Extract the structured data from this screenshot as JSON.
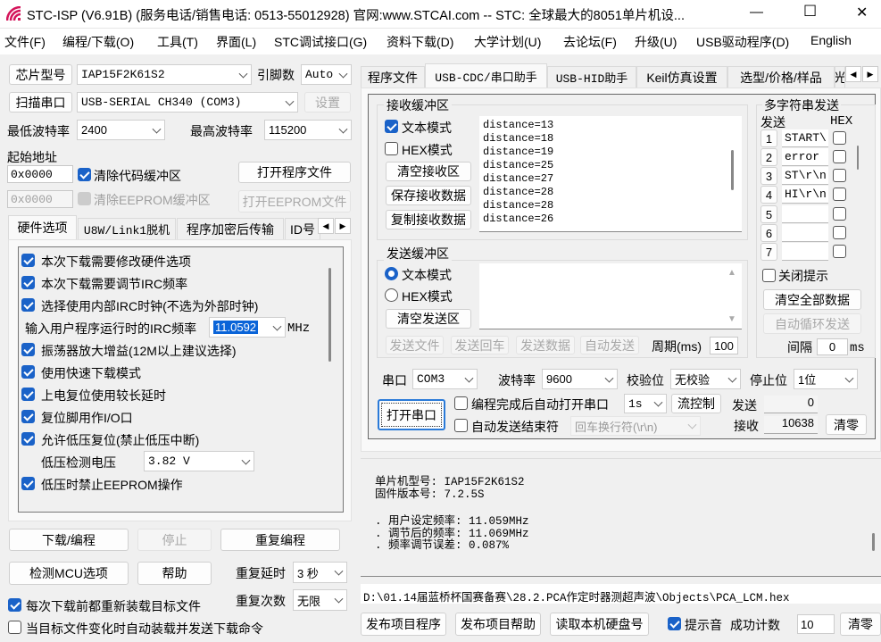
{
  "window": {
    "title": "STC-ISP (V6.91B) (服务电话/销售电话: 0513-55012928) 官网:www.STCAI.com  -- STC: 全球最大的8051单片机设...",
    "minimize": "—",
    "maximize": "☐",
    "close": "✕"
  },
  "menu": [
    "文件(F)",
    "编程/下载(O)",
    "工具(T)",
    "界面(L)",
    "STC调试接口(G)",
    "资料下载(D)",
    "大学计划(U)",
    "去论坛(F)",
    "升级(U)",
    "USB驱动程序(D)",
    "English"
  ],
  "left": {
    "chip_btn": "芯片型号",
    "chip": "IAP15F2K61S2",
    "pins_label": "引脚数",
    "pins": "Auto",
    "scan_btn": "扫描串口",
    "port": "USB-SERIAL CH340 (COM3)",
    "settings_btn": "设置",
    "min_baud_label": "最低波特率",
    "min_baud": "2400",
    "max_baud_label": "最高波特率",
    "max_baud": "115200",
    "start_addr_label": "起始地址",
    "code_addr": "0x0000",
    "clear_code": "清除代码缓冲区",
    "open_prog": "打开程序文件",
    "eeprom_addr": "0x0000",
    "clear_eeprom": "清除EEPROM缓冲区",
    "open_eeprom": "打开EEPROM文件",
    "tabs": [
      "硬件选项",
      "U8W/Link1脱机",
      "程序加密后传输",
      "ID号"
    ],
    "options": [
      {
        "label": "本次下载需要修改硬件选项",
        "checked": true
      },
      {
        "label": "本次下载需要调节IRC频率",
        "checked": true
      },
      {
        "label": "选择使用内部IRC时钟(不选为外部时钟)",
        "checked": true
      }
    ],
    "irc_label": "输入用户程序运行时的IRC频率",
    "irc_value": "11.0592",
    "irc_unit": "MHz",
    "options2": [
      {
        "label": "振荡器放大增益(12M以上建议选择)",
        "checked": true
      },
      {
        "label": "使用快速下载模式",
        "checked": true
      },
      {
        "label": "上电复位使用较长延时",
        "checked": true
      },
      {
        "label": "复位脚用作I/O口",
        "checked": true
      },
      {
        "label": "允许低压复位(禁止低压中断)",
        "checked": true
      }
    ],
    "lvd_label": "低压检测电压",
    "lvd_value": "3.82 V",
    "eeprom_lv": "低压时禁止EEPROM操作",
    "download_btn": "下载/编程",
    "stop_btn": "停止",
    "repeat_btn": "重复编程",
    "detect_btn": "检测MCU选项",
    "help_btn": "帮助",
    "repeat_delay_label": "重复延时",
    "repeat_delay": "3 秒",
    "repeat_count_label": "重复次数",
    "repeat_count": "无限",
    "reload": "每次下载前都重新装载目标文件",
    "auto_load": "当目标文件变化时自动装载并发送下载命令"
  },
  "right": {
    "tabs": [
      "程序文件",
      "USB-CDC/串口助手",
      "USB-HID助手",
      "Keil仿真设置",
      "选型/价格/样品",
      "光"
    ],
    "recv": {
      "title": "接收缓冲区",
      "text_mode": "文本模式",
      "hex_mode": "HEX模式",
      "clear": "清空接收区",
      "save": "保存接收数据",
      "copy": "复制接收数据",
      "lines": [
        "distance=13",
        "distance=18",
        "distance=19",
        "distance=25",
        "distance=27",
        "distance=28",
        "distance=28",
        "distance=26"
      ]
    },
    "send": {
      "title": "发送缓冲区",
      "text_mode": "文本模式",
      "hex_mode": "HEX模式",
      "clear": "清空发送区",
      "send_file": "发送文件",
      "send_cr": "发送回车",
      "send_data": "发送数据",
      "auto_send": "自动发送",
      "period_label": "周期(ms)",
      "period": "100"
    },
    "multi": {
      "title": "多字符串发送",
      "send_col": "发送",
      "hex_col": "HEX",
      "rows": [
        {
          "n": "1",
          "v": "START\\:"
        },
        {
          "n": "2",
          "v": "error"
        },
        {
          "n": "3",
          "v": "ST\\r\\n"
        },
        {
          "n": "4",
          "v": "HI\\r\\n"
        },
        {
          "n": "5",
          "v": ""
        },
        {
          "n": "6",
          "v": ""
        },
        {
          "n": "7",
          "v": ""
        }
      ],
      "close_tip": "关闭提示",
      "clear_all": "清空全部数据",
      "auto_loop": "自动循环发送",
      "interval_label": "间隔",
      "interval": "0",
      "ms": "ms"
    },
    "serial": {
      "port_label": "串口",
      "port": "COM3",
      "baud_label": "波特率",
      "baud": "9600",
      "parity_label": "校验位",
      "parity": "无校验",
      "stop_label": "停止位",
      "stop": "1位",
      "open_btn": "打开串口",
      "auto_open": "编程完成后自动打开串口",
      "auto_open_delay": "1s",
      "flow_btn": "流控制",
      "sent_label": "发送",
      "sent": "0",
      "auto_end": "自动发送结束符",
      "end_char": "回车换行符(\\r\\n)",
      "recv_label": "接收",
      "recv": "10638",
      "clear_btn": "清零"
    }
  },
  "log": {
    "lines": [
      "单片机型号: IAP15F2K61S2",
      "固件版本号: 7.2.5S",
      "",
      ". 用户设定频率: 11.059MHz",
      ". 调节后的频率: 11.069MHz",
      ". 频率调节误差: 0.087%"
    ]
  },
  "path": "D:\\01.14届蓝桥杯国赛备赛\\28.2.PCA作定时器测超声波\\Objects\\PCA_LCM.hex",
  "bottom": {
    "publish_prog": "发布项目程序",
    "publish_help": "发布项目帮助",
    "read_disk": "读取本机硬盘号",
    "beep": "提示音",
    "success_label": "成功计数",
    "success": "10",
    "clear": "清零"
  },
  "colors": {
    "accent": "#1a62c8",
    "title_icon": "#d4145a"
  }
}
